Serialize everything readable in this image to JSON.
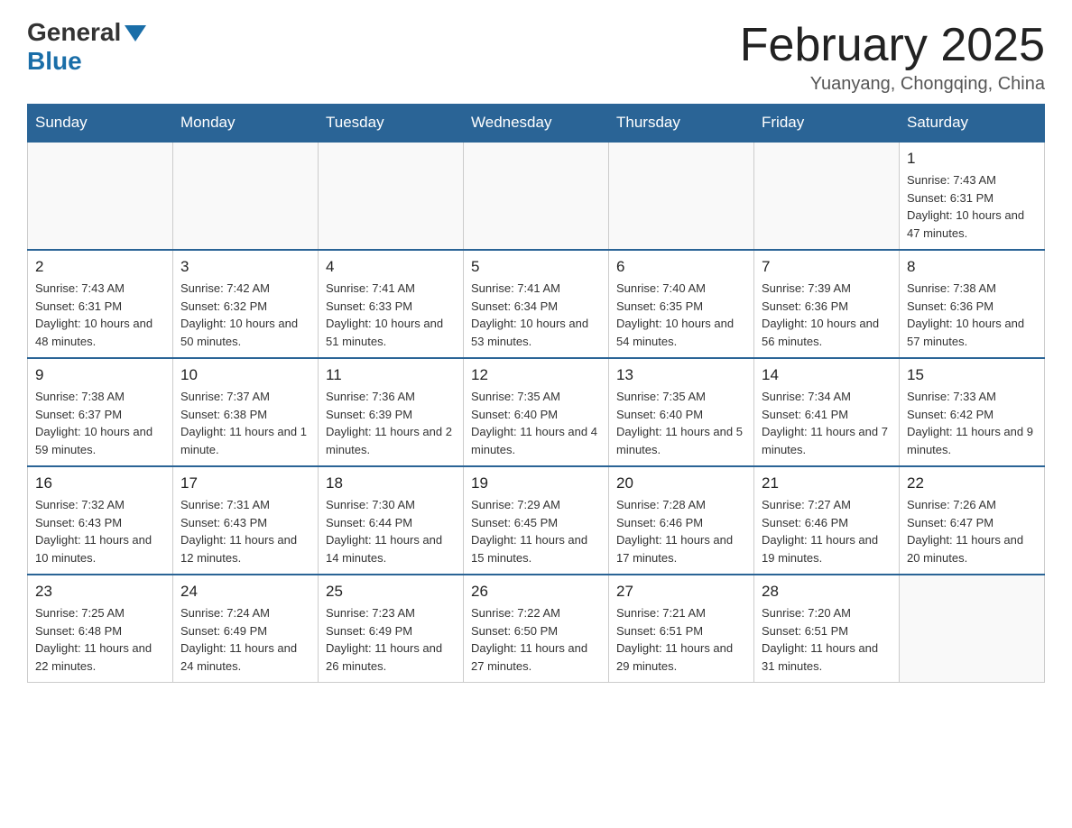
{
  "header": {
    "logo_general": "General",
    "logo_blue": "Blue",
    "month_title": "February 2025",
    "location": "Yuanyang, Chongqing, China"
  },
  "days_of_week": [
    "Sunday",
    "Monday",
    "Tuesday",
    "Wednesday",
    "Thursday",
    "Friday",
    "Saturday"
  ],
  "weeks": [
    {
      "days": [
        {
          "number": "",
          "info": ""
        },
        {
          "number": "",
          "info": ""
        },
        {
          "number": "",
          "info": ""
        },
        {
          "number": "",
          "info": ""
        },
        {
          "number": "",
          "info": ""
        },
        {
          "number": "",
          "info": ""
        },
        {
          "number": "1",
          "info": "Sunrise: 7:43 AM\nSunset: 6:31 PM\nDaylight: 10 hours and 47 minutes."
        }
      ]
    },
    {
      "days": [
        {
          "number": "2",
          "info": "Sunrise: 7:43 AM\nSunset: 6:31 PM\nDaylight: 10 hours and 48 minutes."
        },
        {
          "number": "3",
          "info": "Sunrise: 7:42 AM\nSunset: 6:32 PM\nDaylight: 10 hours and 50 minutes."
        },
        {
          "number": "4",
          "info": "Sunrise: 7:41 AM\nSunset: 6:33 PM\nDaylight: 10 hours and 51 minutes."
        },
        {
          "number": "5",
          "info": "Sunrise: 7:41 AM\nSunset: 6:34 PM\nDaylight: 10 hours and 53 minutes."
        },
        {
          "number": "6",
          "info": "Sunrise: 7:40 AM\nSunset: 6:35 PM\nDaylight: 10 hours and 54 minutes."
        },
        {
          "number": "7",
          "info": "Sunrise: 7:39 AM\nSunset: 6:36 PM\nDaylight: 10 hours and 56 minutes."
        },
        {
          "number": "8",
          "info": "Sunrise: 7:38 AM\nSunset: 6:36 PM\nDaylight: 10 hours and 57 minutes."
        }
      ]
    },
    {
      "days": [
        {
          "number": "9",
          "info": "Sunrise: 7:38 AM\nSunset: 6:37 PM\nDaylight: 10 hours and 59 minutes."
        },
        {
          "number": "10",
          "info": "Sunrise: 7:37 AM\nSunset: 6:38 PM\nDaylight: 11 hours and 1 minute."
        },
        {
          "number": "11",
          "info": "Sunrise: 7:36 AM\nSunset: 6:39 PM\nDaylight: 11 hours and 2 minutes."
        },
        {
          "number": "12",
          "info": "Sunrise: 7:35 AM\nSunset: 6:40 PM\nDaylight: 11 hours and 4 minutes."
        },
        {
          "number": "13",
          "info": "Sunrise: 7:35 AM\nSunset: 6:40 PM\nDaylight: 11 hours and 5 minutes."
        },
        {
          "number": "14",
          "info": "Sunrise: 7:34 AM\nSunset: 6:41 PM\nDaylight: 11 hours and 7 minutes."
        },
        {
          "number": "15",
          "info": "Sunrise: 7:33 AM\nSunset: 6:42 PM\nDaylight: 11 hours and 9 minutes."
        }
      ]
    },
    {
      "days": [
        {
          "number": "16",
          "info": "Sunrise: 7:32 AM\nSunset: 6:43 PM\nDaylight: 11 hours and 10 minutes."
        },
        {
          "number": "17",
          "info": "Sunrise: 7:31 AM\nSunset: 6:43 PM\nDaylight: 11 hours and 12 minutes."
        },
        {
          "number": "18",
          "info": "Sunrise: 7:30 AM\nSunset: 6:44 PM\nDaylight: 11 hours and 14 minutes."
        },
        {
          "number": "19",
          "info": "Sunrise: 7:29 AM\nSunset: 6:45 PM\nDaylight: 11 hours and 15 minutes."
        },
        {
          "number": "20",
          "info": "Sunrise: 7:28 AM\nSunset: 6:46 PM\nDaylight: 11 hours and 17 minutes."
        },
        {
          "number": "21",
          "info": "Sunrise: 7:27 AM\nSunset: 6:46 PM\nDaylight: 11 hours and 19 minutes."
        },
        {
          "number": "22",
          "info": "Sunrise: 7:26 AM\nSunset: 6:47 PM\nDaylight: 11 hours and 20 minutes."
        }
      ]
    },
    {
      "days": [
        {
          "number": "23",
          "info": "Sunrise: 7:25 AM\nSunset: 6:48 PM\nDaylight: 11 hours and 22 minutes."
        },
        {
          "number": "24",
          "info": "Sunrise: 7:24 AM\nSunset: 6:49 PM\nDaylight: 11 hours and 24 minutes."
        },
        {
          "number": "25",
          "info": "Sunrise: 7:23 AM\nSunset: 6:49 PM\nDaylight: 11 hours and 26 minutes."
        },
        {
          "number": "26",
          "info": "Sunrise: 7:22 AM\nSunset: 6:50 PM\nDaylight: 11 hours and 27 minutes."
        },
        {
          "number": "27",
          "info": "Sunrise: 7:21 AM\nSunset: 6:51 PM\nDaylight: 11 hours and 29 minutes."
        },
        {
          "number": "28",
          "info": "Sunrise: 7:20 AM\nSunset: 6:51 PM\nDaylight: 11 hours and 31 minutes."
        },
        {
          "number": "",
          "info": ""
        }
      ]
    }
  ]
}
